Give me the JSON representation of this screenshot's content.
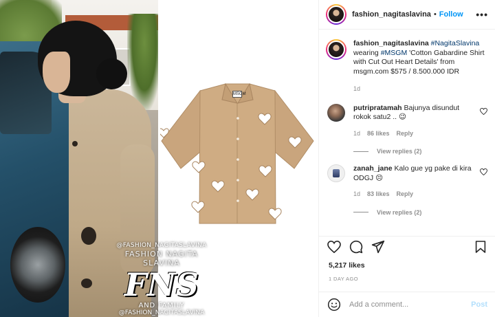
{
  "header": {
    "username": "fashion_nagitaslavina",
    "separator": "•",
    "follow_label": "Follow",
    "more_label": "•••"
  },
  "caption": {
    "username": "fashion_nagitaslavina",
    "mention": "#NagitaSlavina",
    "text_before_tag": "wearing",
    "tag": "#MSGM",
    "text_after_tag": "'Cotton Gabardine Shirt with Cut Out Heart Details' from msgm.com $575 / 8.500.000 IDR",
    "timestamp": "1d"
  },
  "comments": [
    {
      "username": "putripratamah",
      "text": "Bajunya disundut rokok satu2 ..",
      "emoji": "😉",
      "time": "1d",
      "likes": "86 likes",
      "reply_label": "Reply",
      "view_replies": "View replies (2)"
    },
    {
      "username": "zanah_jane",
      "text": "Kalo gue yg pake di kira ODGJ",
      "emoji": "😣",
      "time": "1d",
      "likes": "83 likes",
      "reply_label": "Reply",
      "view_replies": "View replies (2)"
    }
  ],
  "likes": "5,217 likes",
  "date": "1 DAY AGO",
  "add_comment": {
    "placeholder": "Add a comment...",
    "post_label": "Post"
  },
  "watermark": {
    "handle_top": "@FASHION_NAGITASLAVINA",
    "subtitle": "FASHION NAGITA SLAVINA",
    "logo": "FNS",
    "family": "AND FAMILY",
    "handle_bottom": "@FASHION_NAGITASLAVINA"
  },
  "shirt_label": "MSGM",
  "icons": {
    "like": "heart-icon",
    "comment": "comment-icon",
    "share": "send-icon",
    "save": "bookmark-icon",
    "emoji": "emoji-icon",
    "comment_like": "heart-outline-icon"
  },
  "colors": {
    "link": "#00376b",
    "follow": "#0095f6",
    "post_disabled": "#b2dffc",
    "meta": "#8e8e8e"
  }
}
